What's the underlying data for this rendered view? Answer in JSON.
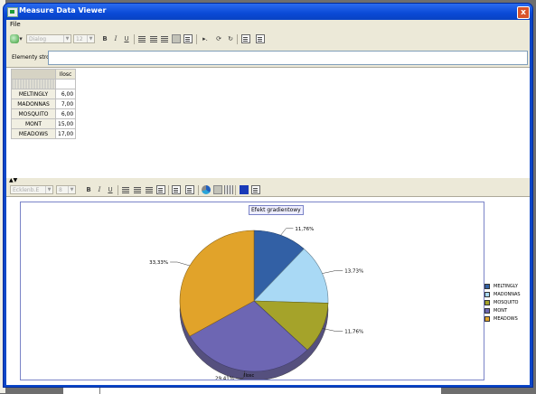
{
  "window": {
    "title": "Measure Data Viewer",
    "close": "x"
  },
  "menu": {
    "file": "File"
  },
  "toolbar": {
    "font": "Dialog",
    "size": "12",
    "bold": "B",
    "italic": "I",
    "underline": "U"
  },
  "elements": {
    "label": "Elementy strony",
    "value": ""
  },
  "table": {
    "column": "Ilosc",
    "rows": [
      {
        "label": "MELTINGLY",
        "value": "6,00"
      },
      {
        "label": "MADONNAS",
        "value": "7,00"
      },
      {
        "label": "MOSQUITO",
        "value": "6,00"
      },
      {
        "label": "MONT",
        "value": "15,00"
      },
      {
        "label": "MEADOWS",
        "value": "17,00"
      }
    ]
  },
  "splitter": "▲▼",
  "toolbar2": {
    "font": "Ecklenb.E",
    "size": "8",
    "bold": "B",
    "italic": "I",
    "underline": "U"
  },
  "chart_data": {
    "type": "pie",
    "title": "Efekt gradientowy",
    "xlabel": "Ilosc",
    "slices": [
      {
        "name": "MELTINGLY",
        "value": 6,
        "label": "11,76%",
        "color": "#3260a5"
      },
      {
        "name": "MADONNAS",
        "value": 7,
        "label": "13,73%",
        "color": "#a9d9f5"
      },
      {
        "name": "MOSQUITO",
        "value": 6,
        "label": "11,76%",
        "color": "#a5a32a"
      },
      {
        "name": "MONT",
        "value": 15,
        "label": "29,41%",
        "color": "#6d66b3"
      },
      {
        "name": "MEADOWS",
        "value": 17,
        "label": "33,33%",
        "color": "#e1a32a"
      }
    ],
    "legend_position": "right"
  }
}
